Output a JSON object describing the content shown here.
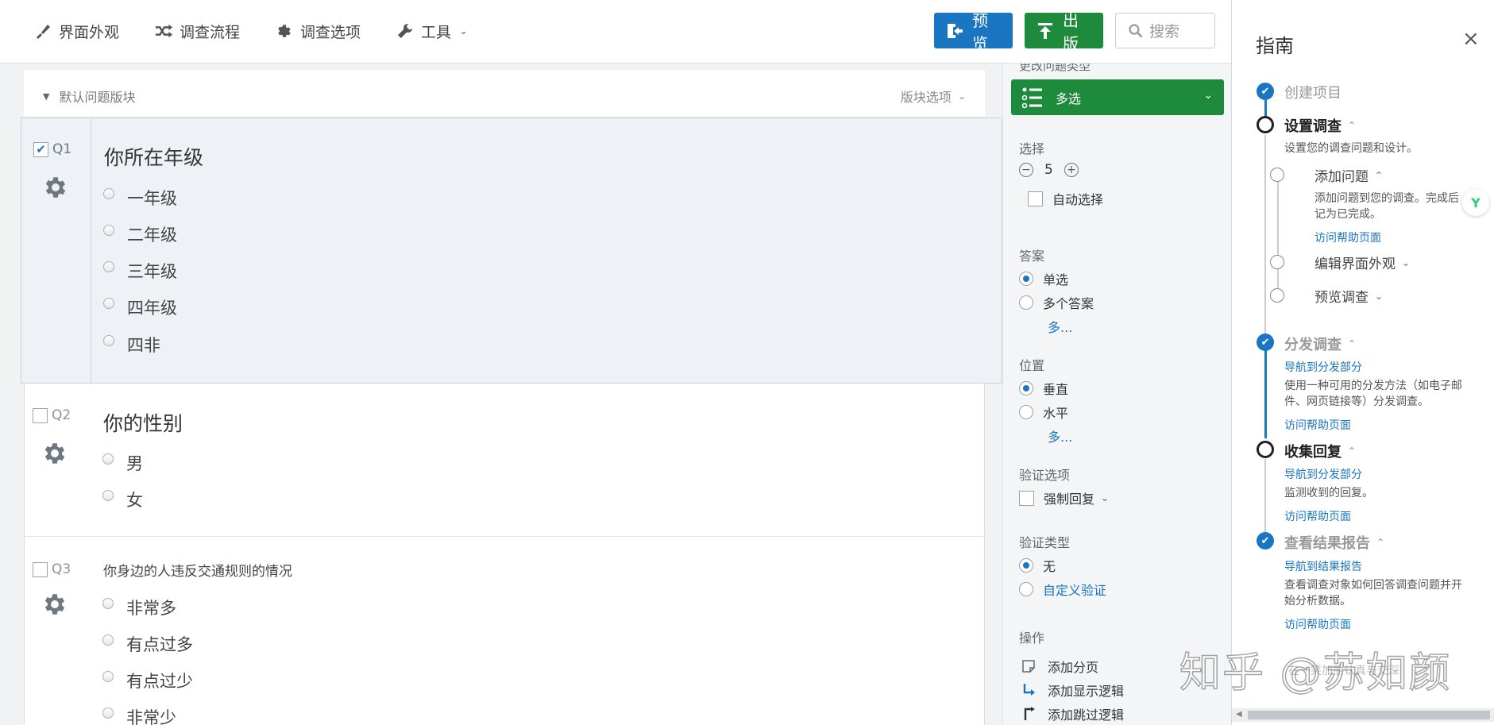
{
  "toolbar": {
    "nav": [
      {
        "label": "界面外观",
        "icon": "paint-brush-icon"
      },
      {
        "label": "调查流程",
        "icon": "flow-icon"
      },
      {
        "label": "调查选项",
        "icon": "gear-icon"
      },
      {
        "label": "工具",
        "icon": "wrench-icon"
      }
    ],
    "preview_label": "预览",
    "publish_label": "出版",
    "search_placeholder": "搜索",
    "preview_color": "#1a75c2",
    "publish_color": "#1e8a3c"
  },
  "block": {
    "title": "默认问题版块",
    "options_label": "版块选项"
  },
  "questions": [
    {
      "number": "Q1",
      "text": "你所在年级",
      "selected": true,
      "choices": [
        "一年级",
        "二年级",
        "三年级",
        "四年级",
        "四非"
      ]
    },
    {
      "number": "Q2",
      "text": "你的性别",
      "selected": false,
      "choices": [
        "男",
        "女"
      ]
    },
    {
      "number": "Q3",
      "text": "你身边的人违反交通规则的情况",
      "selected": false,
      "choices": [
        "非常多",
        "有点过多",
        "有点过少",
        "非常少"
      ]
    }
  ],
  "question_panel": {
    "cut_label": "更改问题类型",
    "type_label": "多选",
    "choices_label": "选择",
    "choices_count": "5",
    "auto_choices_label": "自动选择",
    "answers_label": "答案",
    "answer_single": "单选",
    "answer_multiple": "多个答案",
    "more_label": "多...",
    "position_label": "位置",
    "position_vertical": "垂直",
    "position_horizontal": "水平",
    "validation_options_label": "验证选项",
    "force_response_label": "强制回复",
    "validation_type_label": "验证类型",
    "validation_none": "无",
    "validation_custom": "自定义验证",
    "actions_label": "操作",
    "actions": [
      "添加分页",
      "添加显示逻辑",
      "添加跳过逻辑"
    ],
    "type_color": "#1e8a3c"
  },
  "guide": {
    "title": "指南",
    "close": "×",
    "step_create": "创建项目",
    "step_setup": "设置调查",
    "step_setup_desc": "设置您的调查问题和设计。",
    "sub_add_questions": "添加问题",
    "sub_add_questions_desc_1": "添加问题到您的调查。完成后",
    "sub_add_questions_desc_2": "记为已完成。",
    "help_link": "访问帮助页面",
    "sub_edit_look": "编辑界面外观",
    "sub_preview": "预览调查",
    "step_distribute": "分发调查",
    "nav_distribute": "导航到分发部分",
    "step_distribute_desc_1": "使用一种可用的分发方法（如电子邮",
    "step_distribute_desc_2": "件、网页链接等）分发调查。",
    "step_collect": "收集回复",
    "step_collect_desc": "监测收到的回复。",
    "step_report": "查看结果报告",
    "nav_report": "导航到结果报告",
    "step_report_desc_1": "查看调查对象如何回答调查问题并开",
    "step_report_desc_2": "始分析数据。",
    "accent_color": "#1a75c2"
  },
  "watermark": {
    "text": "知乎 @苏如颜",
    "sub": "在一笑加丽认真与交深"
  }
}
